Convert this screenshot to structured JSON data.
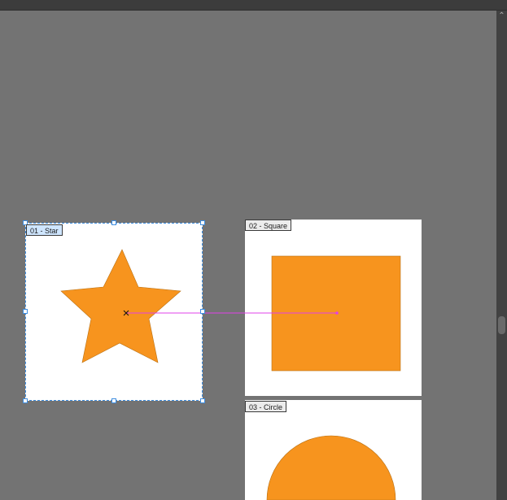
{
  "artboards": [
    {
      "label": "01 - Star",
      "shape": "star",
      "selected": true
    },
    {
      "label": "02 - Square",
      "shape": "square",
      "selected": false
    },
    {
      "label": "03 - Circle",
      "shape": "circle",
      "selected": false
    }
  ],
  "colors": {
    "shape_fill": "#F7941E",
    "shape_stroke": "#b87014",
    "link_line": "#e040e8",
    "selection": "#3d8de0"
  },
  "icons": {
    "scroll_up": "chevron-up-icon",
    "move_cursor": "move-cursor-icon"
  }
}
